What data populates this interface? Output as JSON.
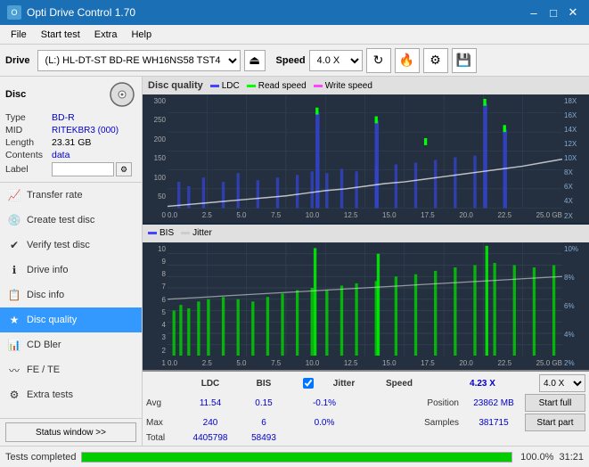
{
  "titleBar": {
    "title": "Opti Drive Control 1.70",
    "minimizeLabel": "–",
    "maximizeLabel": "□",
    "closeLabel": "✕"
  },
  "menuBar": {
    "items": [
      "File",
      "Start test",
      "Extra",
      "Help"
    ]
  },
  "toolbar": {
    "driveLabel": "Drive",
    "driveValue": "(L:)  HL-DT-ST BD-RE  WH16NS58 TST4",
    "speedLabel": "Speed",
    "speedValue": "4.0 X",
    "ejectIcon": "⏏"
  },
  "disc": {
    "title": "Disc",
    "typeLabel": "Type",
    "typeValue": "BD-R",
    "midLabel": "MID",
    "midValue": "RITEKBR3 (000)",
    "lengthLabel": "Length",
    "lengthValue": "23.31 GB",
    "contentsLabel": "Contents",
    "contentsValue": "data",
    "labelLabel": "Label",
    "labelValue": ""
  },
  "navItems": [
    {
      "id": "transfer-rate",
      "label": "Transfer rate",
      "icon": "📈"
    },
    {
      "id": "create-test-disc",
      "label": "Create test disc",
      "icon": "💿"
    },
    {
      "id": "verify-test-disc",
      "label": "Verify test disc",
      "icon": "✔"
    },
    {
      "id": "drive-info",
      "label": "Drive info",
      "icon": "ℹ"
    },
    {
      "id": "disc-info",
      "label": "Disc info",
      "icon": "📋"
    },
    {
      "id": "disc-quality",
      "label": "Disc quality",
      "icon": "★",
      "active": true
    },
    {
      "id": "cd-bler",
      "label": "CD Bler",
      "icon": "📊"
    },
    {
      "id": "fe-te",
      "label": "FE / TE",
      "icon": "〰"
    },
    {
      "id": "extra-tests",
      "label": "Extra tests",
      "icon": "⚙"
    }
  ],
  "statusWindowBtn": "Status window >>",
  "chart": {
    "title": "Disc quality",
    "legend": {
      "ldc": "LDC",
      "read": "Read speed",
      "write": "Write speed"
    },
    "upperYLabels": [
      "300",
      "250",
      "200",
      "150",
      "100",
      "50",
      "0"
    ],
    "upperYLabelsRight": [
      "18X",
      "16X",
      "14X",
      "12X",
      "10X",
      "8X",
      "6X",
      "4X",
      "2X"
    ],
    "xLabels": [
      "0.0",
      "2.5",
      "5.0",
      "7.5",
      "10.0",
      "12.5",
      "15.0",
      "17.5",
      "20.0",
      "22.5",
      "25.0"
    ],
    "xUnit": "GB",
    "lowerTitle": "BIS",
    "lowerLegend": "Jitter",
    "lowerYLabels": [
      "10",
      "9",
      "8",
      "7",
      "6",
      "5",
      "4",
      "3",
      "2",
      "1"
    ],
    "lowerYLabelsRight": [
      "10%",
      "8%",
      "6%",
      "4%",
      "2%"
    ]
  },
  "statsHeaders": {
    "ldc": "LDC",
    "bis": "BIS",
    "jitter": "Jitter",
    "speed": "Speed",
    "position": "Position",
    "samples": "Samples"
  },
  "stats": {
    "avgLdc": "11.54",
    "avgBis": "0.15",
    "avgJitter": "-0.1%",
    "speedValue": "4.23 X",
    "speedSelect": "4.0 X",
    "positionLabel": "Position",
    "positionValue": "23862 MB",
    "samplesLabel": "Samples",
    "samplesValue": "381715",
    "maxLdc": "240",
    "maxBis": "6",
    "maxJitter": "0.0%",
    "totalLdc": "4405798",
    "totalBis": "58493",
    "rowLabels": [
      "Avg",
      "Max",
      "Total"
    ],
    "startFullBtn": "Start full",
    "startPartBtn": "Start part",
    "jitterChecked": true,
    "jitterLabel": "Jitter"
  },
  "statusBar": {
    "text": "Tests completed",
    "progress": 100,
    "progressText": "100.0%",
    "time": "31:21"
  }
}
